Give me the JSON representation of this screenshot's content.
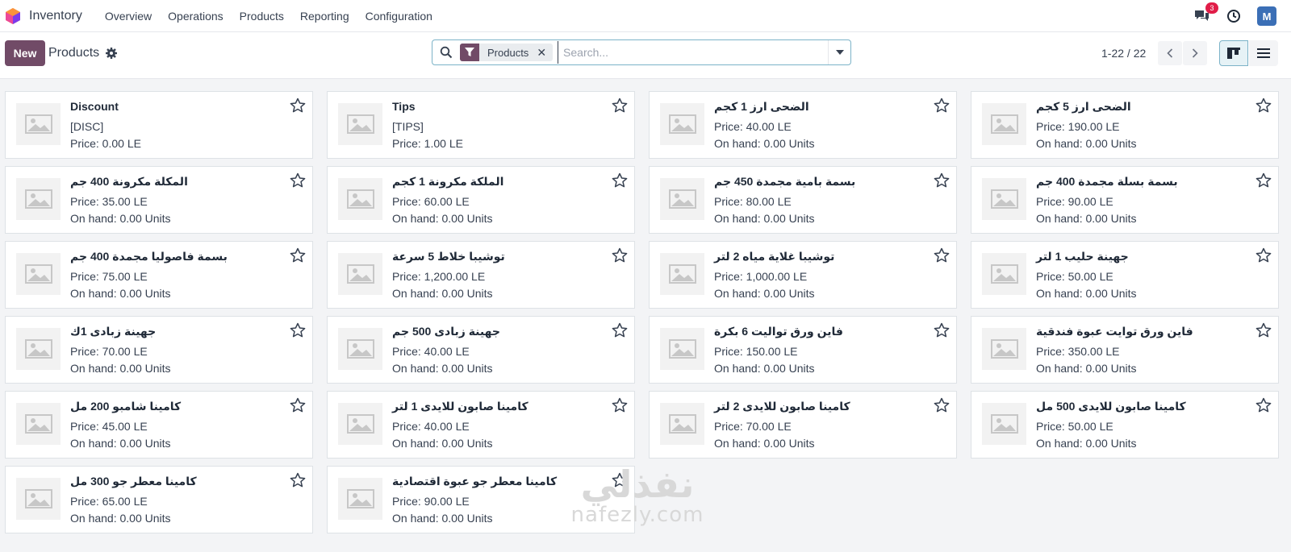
{
  "app": {
    "name": "Inventory"
  },
  "nav": {
    "items": [
      "Overview",
      "Operations",
      "Products",
      "Reporting",
      "Configuration"
    ]
  },
  "systray": {
    "message_count": "3",
    "avatar_letter": "M"
  },
  "control_panel": {
    "new_label": "New",
    "title": "Products",
    "search": {
      "facet": "Products",
      "placeholder": "Search..."
    },
    "pager": "1-22 / 22"
  },
  "colors": {
    "brand": "#714b67",
    "accent": "#7cb3c8",
    "badge": "#e11d48"
  },
  "products": [
    {
      "name": "Discount",
      "line1": "[DISC]",
      "line2": "Price: 0.00 LE"
    },
    {
      "name": "Tips",
      "line1": "[TIPS]",
      "line2": "Price: 1.00 LE"
    },
    {
      "name": "الضحى ارز 1 كجم",
      "line1": "Price: 40.00 LE",
      "line2": "On hand: 0.00 Units"
    },
    {
      "name": "الضحى ارز 5 كجم",
      "line1": "Price: 190.00 LE",
      "line2": "On hand: 0.00 Units"
    },
    {
      "name": "المكلة مكرونة 400 جم",
      "line1": "Price: 35.00 LE",
      "line2": "On hand: 0.00 Units"
    },
    {
      "name": "الملكة مكرونة 1 كجم",
      "line1": "Price: 60.00 LE",
      "line2": "On hand: 0.00 Units"
    },
    {
      "name": "بسمة بامية مجمدة 450 جم",
      "line1": "Price: 80.00 LE",
      "line2": "On hand: 0.00 Units"
    },
    {
      "name": "بسمة بسلة مجمدة 400 جم",
      "line1": "Price: 90.00 LE",
      "line2": "On hand: 0.00 Units"
    },
    {
      "name": "بسمة فاصوليا مجمدة 400 جم",
      "line1": "Price: 75.00 LE",
      "line2": "On hand: 0.00 Units"
    },
    {
      "name": "توشيبا خلاط 5 سرعة",
      "line1": "Price: 1,200.00 LE",
      "line2": "On hand: 0.00 Units"
    },
    {
      "name": "توشيبا غلاية مياه 2 لتر",
      "line1": "Price: 1,000.00 LE",
      "line2": "On hand: 0.00 Units"
    },
    {
      "name": "جهينة حليب 1 لتر",
      "line1": "Price: 50.00 LE",
      "line2": "On hand: 0.00 Units"
    },
    {
      "name": "جهينة زبادى 1ك",
      "line1": "Price: 70.00 LE",
      "line2": "On hand: 0.00 Units"
    },
    {
      "name": "جهينة زبادى 500 جم",
      "line1": "Price: 40.00 LE",
      "line2": "On hand: 0.00 Units"
    },
    {
      "name": "فاين ورق تواليت 6 بكرة",
      "line1": "Price: 150.00 LE",
      "line2": "On hand: 0.00 Units"
    },
    {
      "name": "فاين ورق توايت عبوة فندقية",
      "line1": "Price: 350.00 LE",
      "line2": "On hand: 0.00 Units"
    },
    {
      "name": "كامينا شامبو 200 مل",
      "line1": "Price: 45.00 LE",
      "line2": "On hand: 0.00 Units"
    },
    {
      "name": "كامينا صابون للايدى 1 لتر",
      "line1": "Price: 40.00 LE",
      "line2": "On hand: 0.00 Units"
    },
    {
      "name": "كامينا صابون للايدى 2 لتر",
      "line1": "Price: 70.00 LE",
      "line2": "On hand: 0.00 Units"
    },
    {
      "name": "كامينا صابون للايدى 500 مل",
      "line1": "Price: 50.00 LE",
      "line2": "On hand: 0.00 Units"
    },
    {
      "name": "كامينا معطر جو 300 مل",
      "line1": "Price: 65.00 LE",
      "line2": "On hand: 0.00 Units"
    },
    {
      "name": "كامينا معطر جو عبوة اقتصادية",
      "line1": "Price: 90.00 LE",
      "line2": "On hand: 0.00 Units"
    }
  ],
  "watermark": {
    "arabic": "نفذلي",
    "latin": "nafezly.com"
  }
}
